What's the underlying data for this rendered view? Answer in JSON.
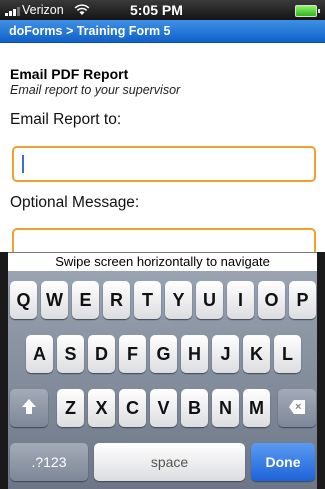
{
  "status": {
    "carrier": "Verizon",
    "time": "5:05 PM"
  },
  "nav": {
    "title": "doForms > Training Form 5"
  },
  "form": {
    "section_title": "Email PDF Report",
    "section_subtitle": "Email report to your supervisor",
    "email_label": "Email Report to:",
    "email_value": "",
    "message_label": "Optional Message:",
    "message_value": ""
  },
  "hint": "Swipe screen horizontally to navigate",
  "keyboard": {
    "row1": [
      "Q",
      "W",
      "E",
      "R",
      "T",
      "Y",
      "U",
      "I",
      "O",
      "P"
    ],
    "row2": [
      "A",
      "S",
      "D",
      "F",
      "G",
      "H",
      "J",
      "K",
      "L"
    ],
    "row3": [
      "Z",
      "X",
      "C",
      "V",
      "B",
      "N",
      "M"
    ],
    "numbers_label": ".?123",
    "space_label": "space",
    "done_label": "Done"
  },
  "colors": {
    "nav_blue": "#1f74dc",
    "input_border": "#f0a030",
    "done_blue": "#1d63d8"
  }
}
